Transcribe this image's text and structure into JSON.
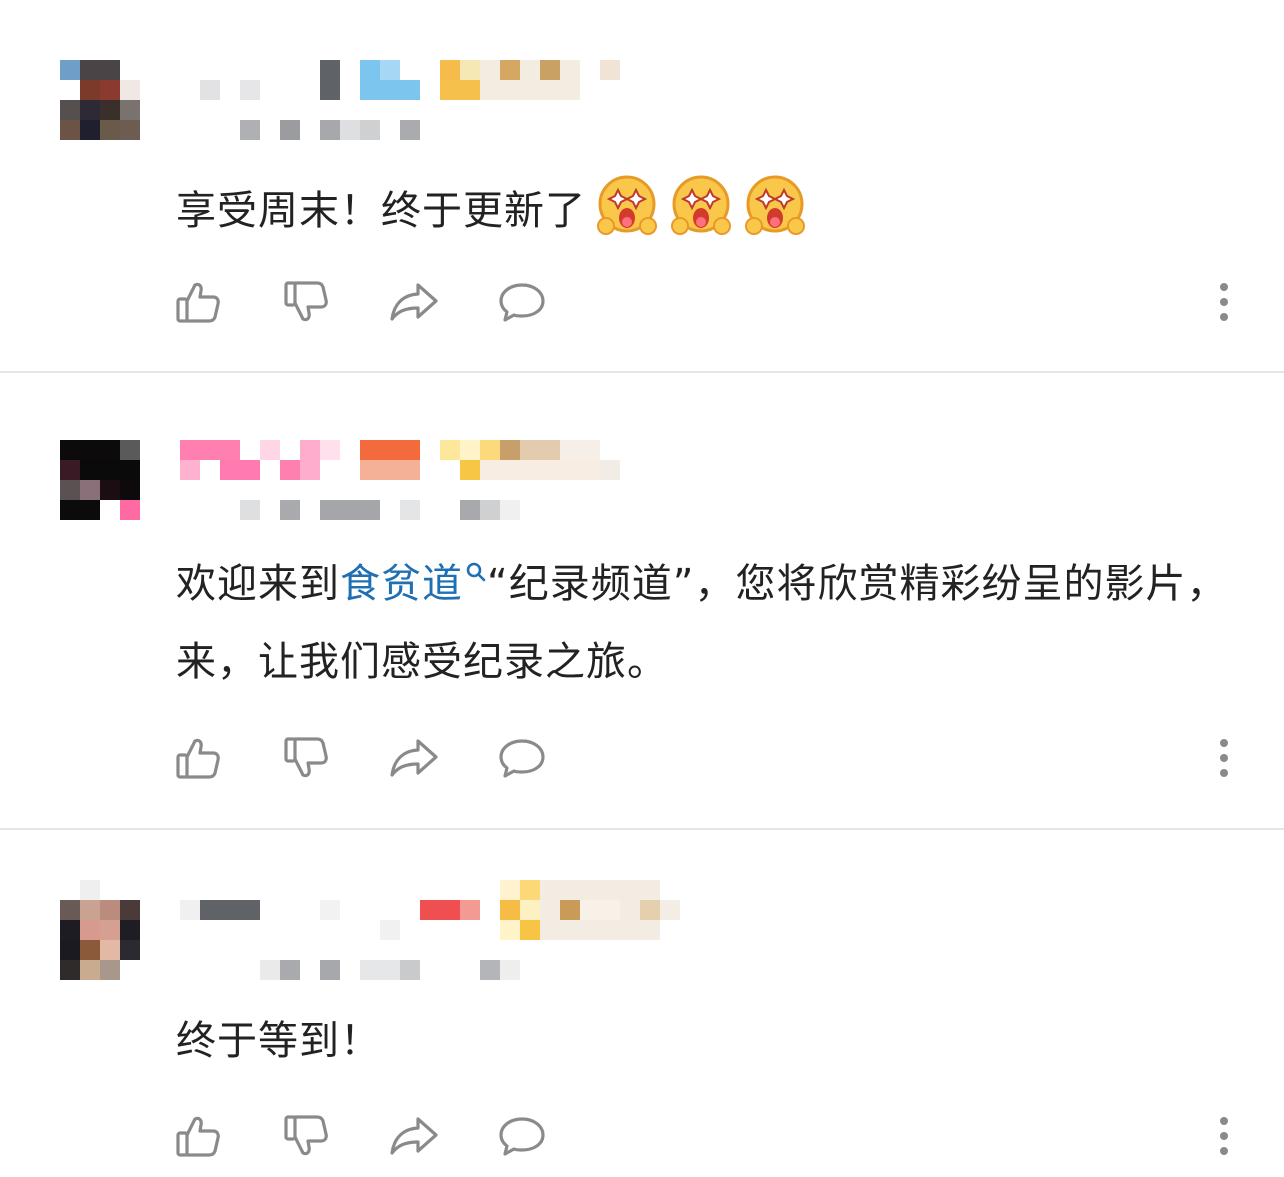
{
  "comments": [
    {
      "text": "享受周末！终于更新了",
      "emoji_count": 3
    },
    {
      "text_before": "欢迎来到",
      "link_text": "食贫道",
      "text_after": "“纪录频道”，您将欣赏精彩纷呈的影片，来，让我们感受纪录之旅。"
    },
    {
      "text": "终于等到！"
    }
  ],
  "icons": {
    "like": "thumbs-up-icon",
    "dislike": "thumbs-down-icon",
    "share": "share-arrow-icon",
    "reply": "comment-bubble-icon",
    "more": "more-vertical-icon",
    "emoji": "starry-eyes-emoji-icon"
  },
  "colors": {
    "link": "#1f6fb3",
    "text": "#222222",
    "icon": "#8a8a8a",
    "divider": "#e6e6e6"
  }
}
